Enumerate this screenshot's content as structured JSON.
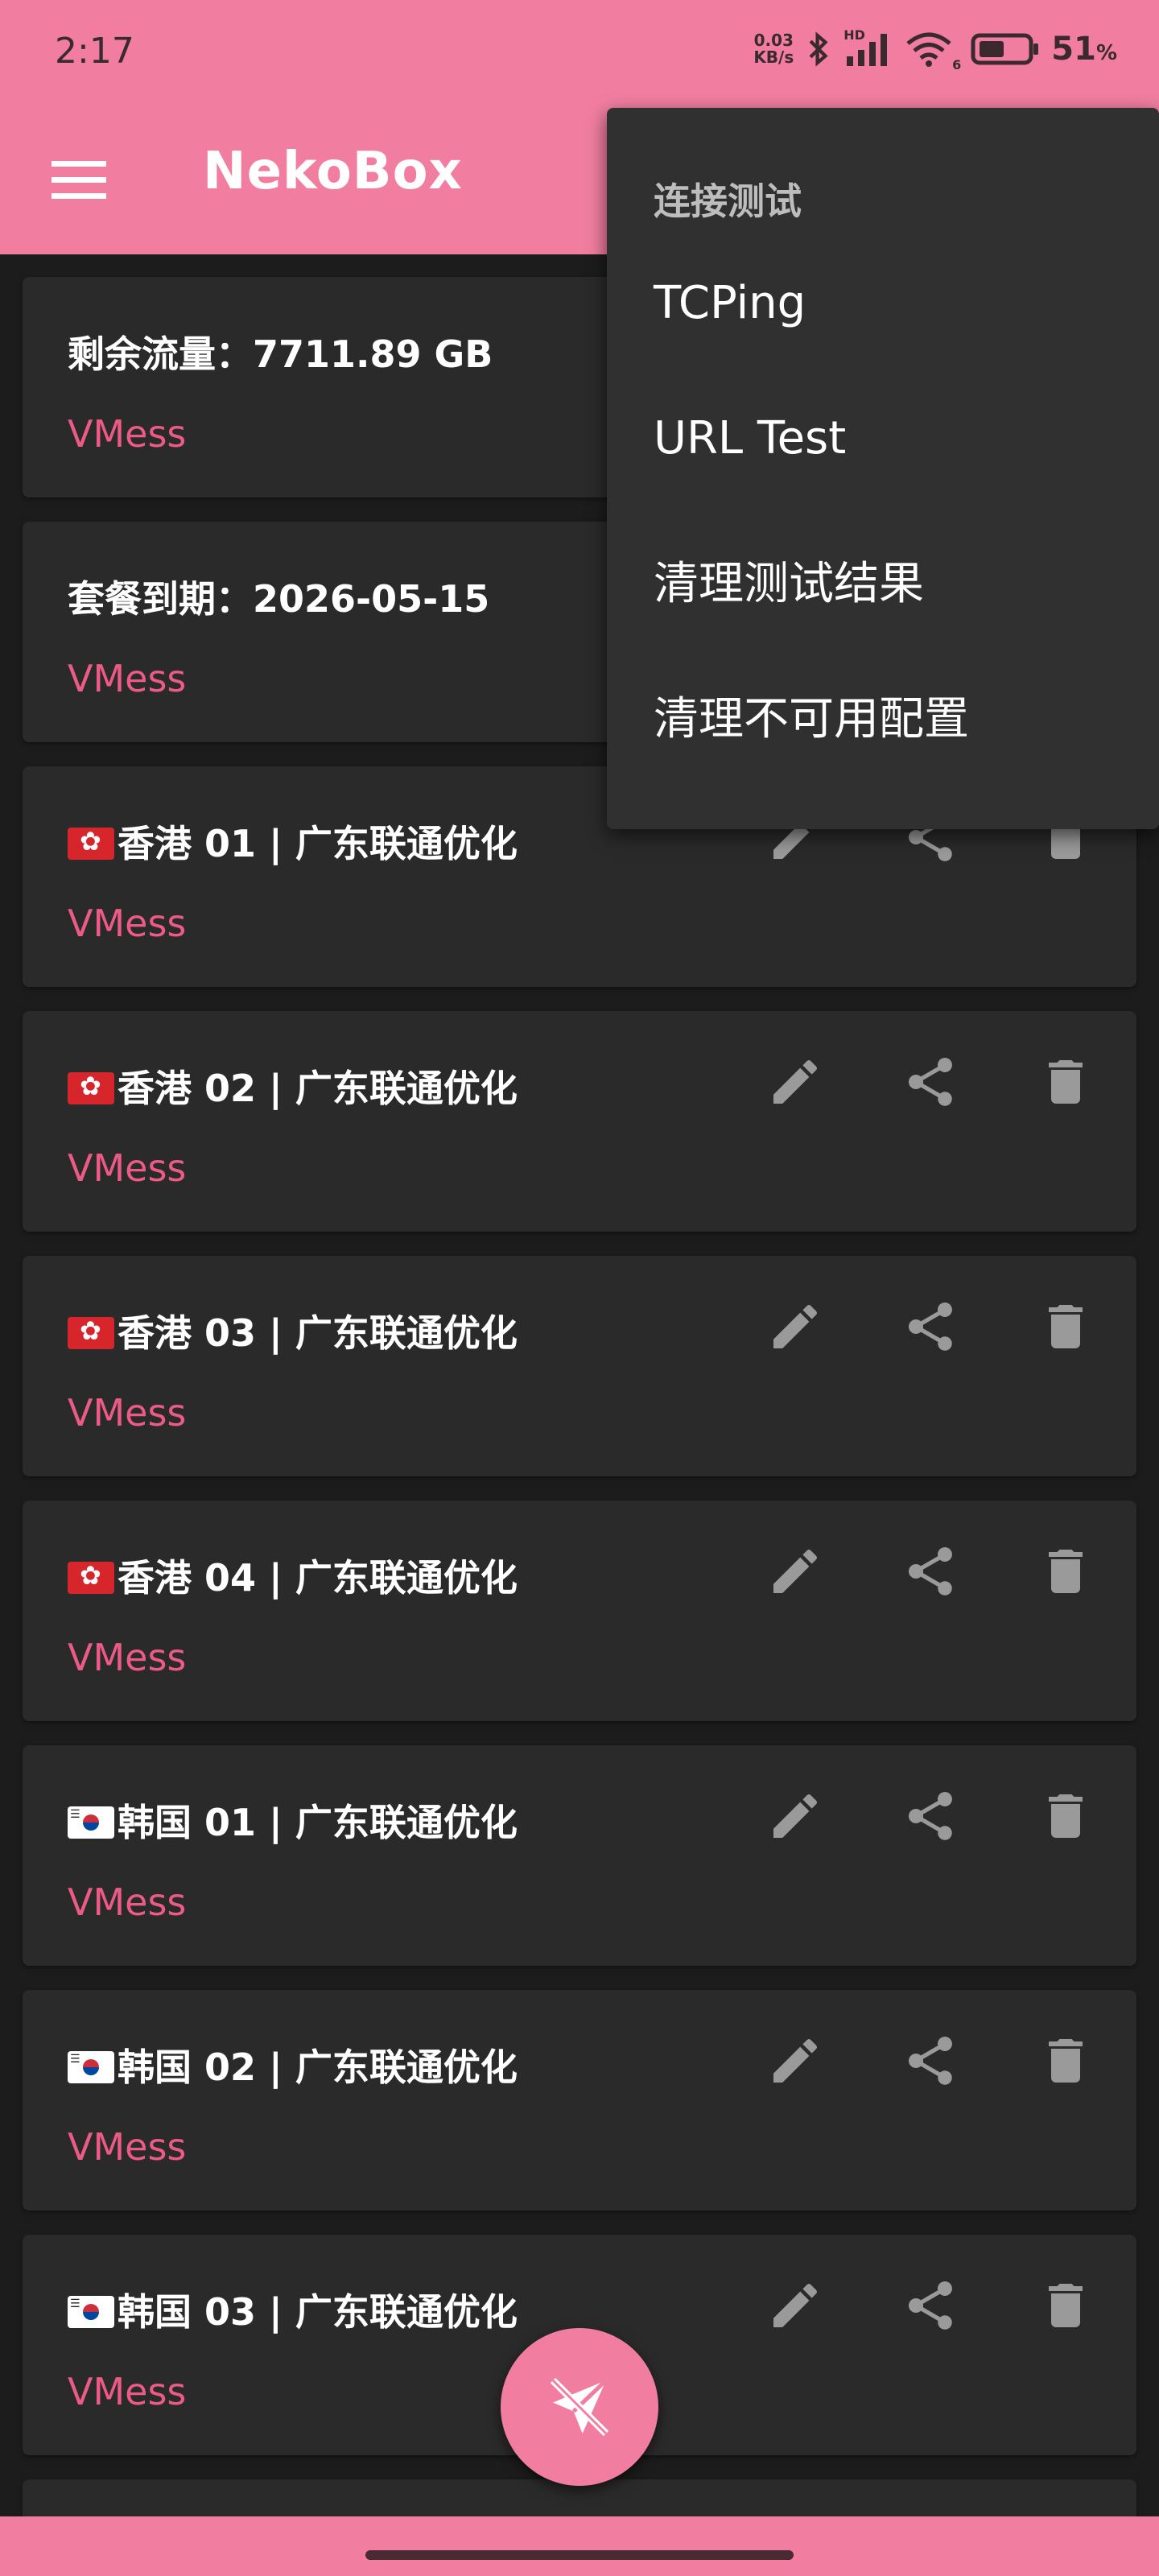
{
  "status_bar": {
    "time": "2:17",
    "net_speed_value": "0.03",
    "net_speed_unit": "KB/s",
    "hd_label": "HD",
    "wifi_badge": "6",
    "battery_percent": "51",
    "battery_unit": "%"
  },
  "app_bar": {
    "title": "NekoBox",
    "menu_icon": "hamburger-menu-icon"
  },
  "dropdown": {
    "header": "连接测试",
    "items": [
      {
        "label": "TCPing"
      },
      {
        "label": "URL Test"
      },
      {
        "label": "清理测试结果"
      },
      {
        "label": "清理不可用配置"
      }
    ]
  },
  "profiles": [
    {
      "title": "剩余流量：7711.89 GB",
      "type": "VMess",
      "flag": ""
    },
    {
      "title": "套餐到期：2026-05-15",
      "type": "VMess",
      "flag": ""
    },
    {
      "title": "香港 01 | 广东联通优化",
      "type": "VMess",
      "flag": "hk"
    },
    {
      "title": "香港 02 | 广东联通优化",
      "type": "VMess",
      "flag": "hk"
    },
    {
      "title": "香港 03 | 广东联通优化",
      "type": "VMess",
      "flag": "hk"
    },
    {
      "title": "香港 04 | 广东联通优化",
      "type": "VMess",
      "flag": "hk"
    },
    {
      "title": "韩国 01 | 广东联通优化",
      "type": "VMess",
      "flag": "kr"
    },
    {
      "title": "韩国 02 | 广东联通优化",
      "type": "VMess",
      "flag": "kr"
    },
    {
      "title": "韩国 03 | 广东联通优化",
      "type": "VMess",
      "flag": "kr"
    }
  ],
  "actions": {
    "edit_icon": "pencil-edit-icon",
    "share_icon": "share-icon",
    "delete_icon": "trash-delete-icon"
  },
  "fab": {
    "icon": "paper-plane-disconnected-icon"
  },
  "colors": {
    "accent": "#f17ea0",
    "vmess_text": "#ec5b86",
    "card_bg": "#2a2a2a",
    "menu_bg": "#303030",
    "background": "#1c1c1c"
  }
}
